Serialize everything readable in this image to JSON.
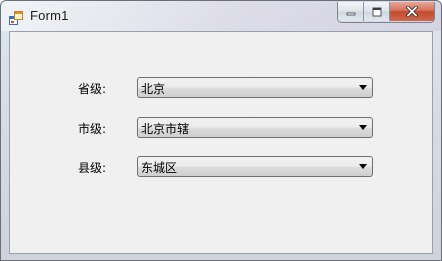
{
  "window": {
    "title": "Form1"
  },
  "form": {
    "province": {
      "label": "省级:",
      "value": "北京"
    },
    "city": {
      "label": "市级:",
      "value": "北京市辖"
    },
    "county": {
      "label": "县级:",
      "value": "东城区"
    }
  },
  "icons": {
    "app": "form-app-icon",
    "minimize": "minimize-icon",
    "maximize": "maximize-icon",
    "close": "close-icon",
    "dropdown": "chevron-down-icon"
  },
  "colors": {
    "client_background": "#f0f0f0",
    "close_button": "#c94a30"
  }
}
